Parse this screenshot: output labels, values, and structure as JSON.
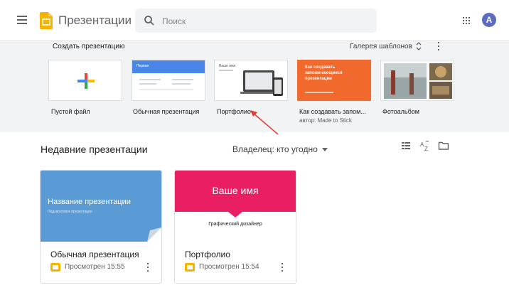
{
  "header": {
    "app_title": "Презентации",
    "search_placeholder": "Поиск",
    "avatar_letter": "A",
    "brand_color": "#f4b400",
    "avatar_color": "#5c6bc0"
  },
  "templates": {
    "heading": "Создать презентацию",
    "gallery_label": "Галерея шаблонов",
    "items": [
      {
        "label": "Пустой файл"
      },
      {
        "label": "Обычная презентация",
        "thumb_title": "Первая"
      },
      {
        "label": "Портфолио",
        "thumb_title": "Ваше имя"
      },
      {
        "label": "Как создавать запом...",
        "sublabel": "автор: Made to Stick",
        "thumb_title": "Как создавать запоминающиеся презентации"
      },
      {
        "label": "Фотоальбом"
      }
    ]
  },
  "recent": {
    "title": "Недавние презентации",
    "owner_filter": "Владелец: кто угодно",
    "icons": [
      "list-view-icon",
      "sort-az-icon",
      "folder-icon"
    ],
    "cards": [
      {
        "preview_title": "Название презентации",
        "preview_subtitle": "Подзаголовок презентации",
        "name": "Обычная презентация",
        "meta": "Просмотрен 15:55"
      },
      {
        "preview_title": "Ваше имя",
        "preview_subtitle": "Графический дизайнер",
        "name": "Портфолио",
        "meta": "Просмотрен 15:54"
      }
    ]
  }
}
